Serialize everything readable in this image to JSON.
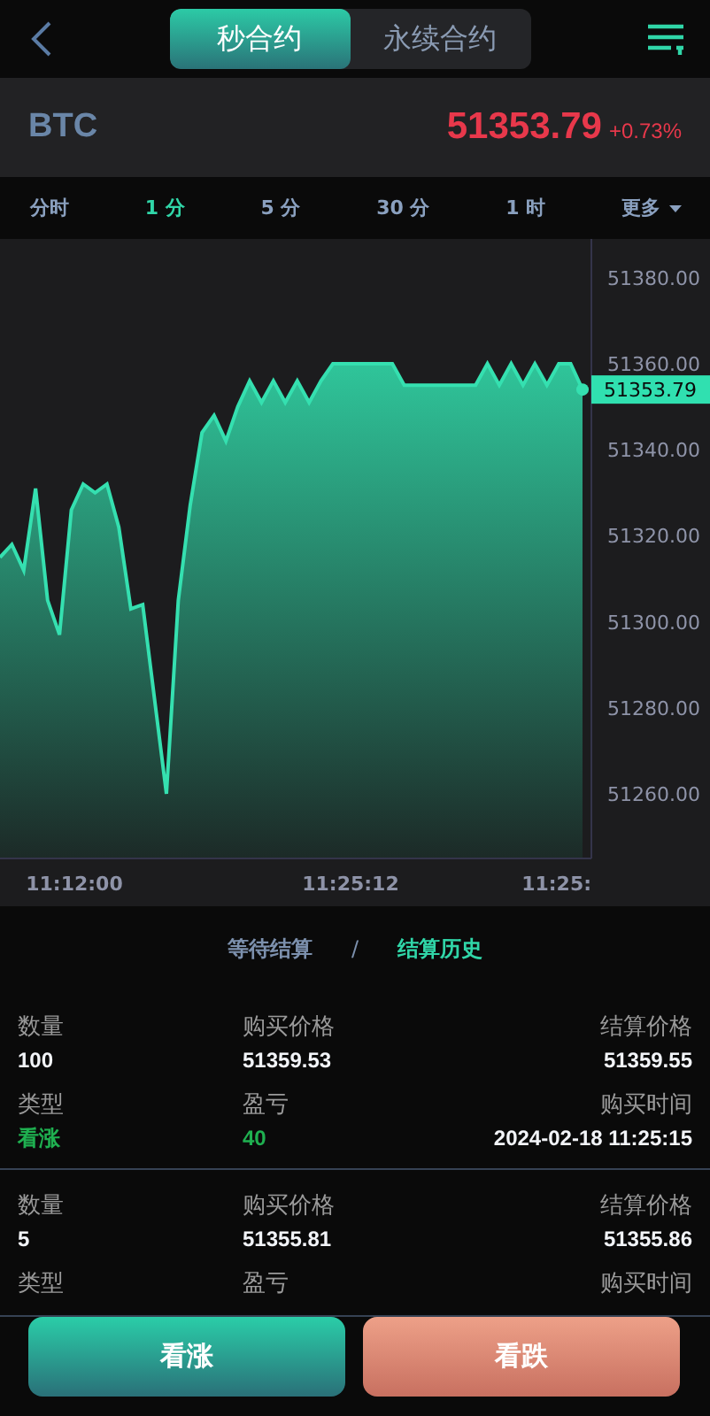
{
  "header": {
    "tabs": [
      {
        "label": "秒合约",
        "selected": true
      },
      {
        "label": "永续合约",
        "selected": false
      }
    ]
  },
  "ticker": {
    "symbol": "BTC",
    "price": "51353.79",
    "change": "+0.73%"
  },
  "intervals": [
    {
      "label": "分时",
      "selected": false,
      "kind": "option"
    },
    {
      "label": "1 分",
      "selected": true,
      "kind": "option"
    },
    {
      "label": "5 分",
      "selected": false,
      "kind": "option"
    },
    {
      "label": "30 分",
      "selected": false,
      "kind": "option"
    },
    {
      "label": "1 时",
      "selected": false,
      "kind": "option"
    },
    {
      "label": "更多",
      "selected": false,
      "kind": "dropdown"
    }
  ],
  "chart": {
    "price_tag": "51353.79",
    "time_labels": [
      "11:12:00",
      "11:25:12",
      "11:25:"
    ],
    "chart_data": {
      "type": "area",
      "ylim": [
        51245,
        51389
      ],
      "yticks": [
        {
          "value": 51380,
          "label": "51380.00"
        },
        {
          "value": 51360,
          "label": "51360.00"
        },
        {
          "value": 51340,
          "label": "51340.00"
        },
        {
          "value": 51320,
          "label": "51320.00"
        },
        {
          "value": 51300,
          "label": "51300.00"
        },
        {
          "value": 51280,
          "label": "51280.00"
        },
        {
          "value": 51260,
          "label": "51260.00"
        }
      ],
      "series": [
        {
          "color": "#35e0b0",
          "values": [
            51315,
            51318,
            51312,
            51331,
            51305,
            51297,
            51326,
            51332,
            51330,
            51332,
            51322,
            51303,
            51304,
            51282,
            51260,
            51305,
            51327,
            51344,
            51348,
            51342,
            51350,
            51356,
            51351,
            51356,
            51351,
            51356,
            51351,
            51356,
            51360,
            51360,
            51360,
            51360,
            51360,
            51360,
            51355,
            51355,
            51355,
            51355,
            51355,
            51355,
            51355,
            51360,
            51355,
            51360,
            51355,
            51360,
            51355,
            51360,
            51360,
            51354
          ]
        }
      ]
    }
  },
  "record_tabs": {
    "items": [
      {
        "label": "等待结算",
        "selected": false
      },
      {
        "label": "结算历史",
        "selected": true
      }
    ],
    "separator": "/"
  },
  "records": [
    {
      "fields": [
        {
          "label": "数量",
          "value": "100"
        },
        {
          "label": "购买价格",
          "value": "51359.53"
        },
        {
          "label": "结算价格",
          "value": "51359.55"
        },
        {
          "label": "类型",
          "value": "看涨",
          "color": "#1fb050"
        },
        {
          "label": "盈亏",
          "value": "40",
          "color": "#1fb050"
        },
        {
          "label": "购买时间",
          "value": "2024-02-18 11:25:15"
        }
      ]
    },
    {
      "fields": [
        {
          "label": "数量",
          "value": "5"
        },
        {
          "label": "购买价格",
          "value": "51355.81"
        },
        {
          "label": "结算价格",
          "value": "51355.86"
        },
        {
          "label": "类型"
        },
        {
          "label": "盈亏"
        },
        {
          "label": "购买时间"
        }
      ]
    }
  ],
  "actions": [
    {
      "label": "看涨",
      "kind": "up"
    },
    {
      "label": "看跌",
      "kind": "down"
    }
  ]
}
